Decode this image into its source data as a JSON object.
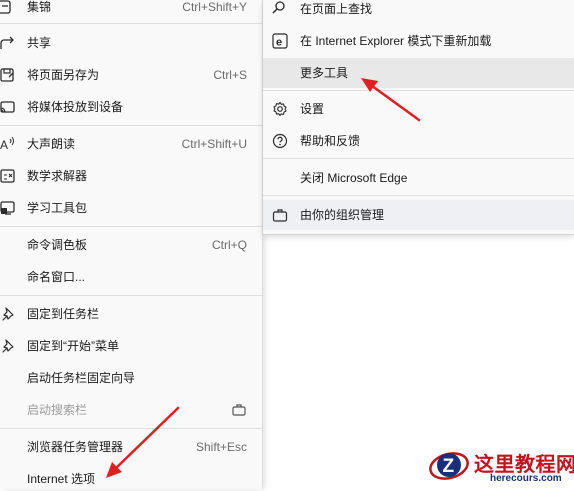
{
  "left_menu": {
    "items": [
      {
        "label": "集锦",
        "shortcut": "Ctrl+Shift+Y",
        "icon": "collections-icon"
      },
      {
        "label": "共享",
        "shortcut": "",
        "icon": "share-icon"
      },
      {
        "label": "将页面另存为",
        "shortcut": "Ctrl+S",
        "icon": "save-page-icon"
      },
      {
        "label": "将媒体投放到设备",
        "shortcut": "",
        "icon": "cast-icon"
      },
      {
        "label": "大声朗读",
        "shortcut": "Ctrl+Shift+U",
        "icon": "read-aloud-icon"
      },
      {
        "label": "数学求解器",
        "shortcut": "",
        "icon": "math-solver-icon"
      },
      {
        "label": "学习工具包",
        "shortcut": "",
        "icon": "learning-toolkit-icon"
      },
      {
        "label": "命令调色板",
        "shortcut": "Ctrl+Q",
        "icon": ""
      },
      {
        "label": "命名窗口...",
        "shortcut": "",
        "icon": ""
      },
      {
        "label": "固定到任务栏",
        "shortcut": "",
        "icon": "pin-icon"
      },
      {
        "label": "固定到“开始”菜单",
        "shortcut": "",
        "icon": "pin-icon"
      },
      {
        "label": "启动任务栏固定向导",
        "shortcut": "",
        "icon": ""
      },
      {
        "label": "启动搜索栏",
        "shortcut": "",
        "icon": ""
      },
      {
        "label": "浏览器任务管理器",
        "shortcut": "Shift+Esc",
        "icon": ""
      },
      {
        "label": "Internet 选项",
        "shortcut": "",
        "icon": ""
      }
    ]
  },
  "right_menu": {
    "items": [
      {
        "label": "在页面上查找",
        "icon": "find-icon"
      },
      {
        "label": "在 Internet Explorer 模式下重新加载",
        "icon": "ie-icon"
      },
      {
        "label": "更多工具",
        "icon": ""
      },
      {
        "label": "设置",
        "icon": "gear-icon"
      },
      {
        "label": "帮助和反馈",
        "icon": "help-icon"
      },
      {
        "label": "关闭 Microsoft Edge",
        "icon": ""
      },
      {
        "label": "由你的组织管理",
        "icon": "briefcase-icon"
      }
    ]
  },
  "watermark": {
    "title": "这里教程网",
    "url": "herecours.com"
  },
  "colors": {
    "arrow": "#e02020",
    "menu_bg": "#f9f9f9",
    "highlight": "#e8e8e8"
  }
}
